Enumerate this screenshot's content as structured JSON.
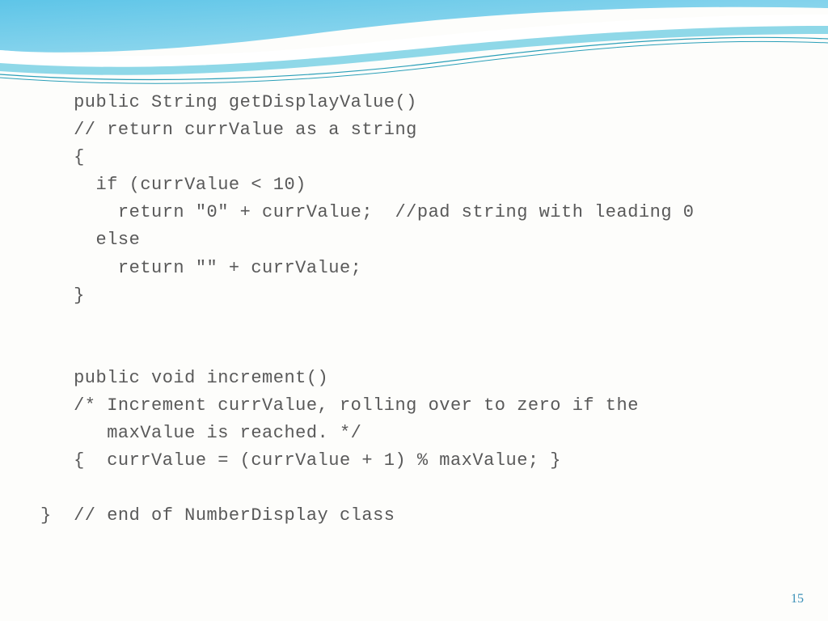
{
  "code": {
    "line1": "   public String getDisplayValue()",
    "line2": "   // return currValue as a string",
    "line3": "   {",
    "line4": "     if (currValue < 10)",
    "line5": "       return \"0\" + currValue;  //pad string with leading 0",
    "line6": "     else",
    "line7": "       return \"\" + currValue;",
    "line8": "   }",
    "line9": "",
    "line10": "",
    "line11": "   public void increment()",
    "line12": "   /* Increment currValue, rolling over to zero if the",
    "line13": "      maxValue is reached. */",
    "line14": "   {  currValue = (currValue + 1) % maxValue; }",
    "line15": "",
    "line16": "}  // end of NumberDisplay class"
  },
  "page_number": "15"
}
